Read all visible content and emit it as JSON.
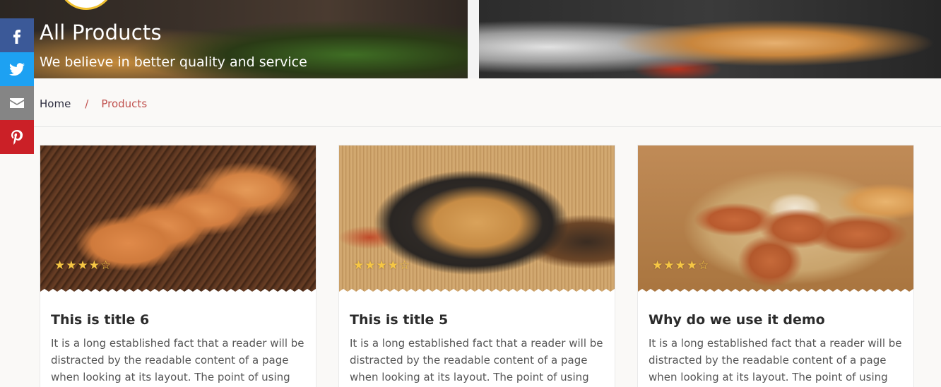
{
  "hero": {
    "title": "All Products",
    "subtitle": "We believe in better quality and service"
  },
  "share": {
    "items": [
      {
        "network": "facebook",
        "icon": "facebook-icon",
        "color": "#3b5998"
      },
      {
        "network": "twitter",
        "icon": "twitter-icon",
        "color": "#1da1f2"
      },
      {
        "network": "email",
        "icon": "mail-icon",
        "color": "#858585"
      },
      {
        "network": "pinterest",
        "icon": "pinterest-icon",
        "color": "#cb2027"
      }
    ]
  },
  "breadcrumb": {
    "home": "Home",
    "separator": "/",
    "current": "Products"
  },
  "colors": {
    "accent": "#c0504d",
    "star": "#f6c644"
  },
  "products": [
    {
      "title": "This is title 6",
      "rating": 4,
      "rating_max": 5,
      "description": "It is a long established fact that a reader will be distracted by the readable content of a page when looking at its layout. The point of using Lorem"
    },
    {
      "title": "This is title 5",
      "rating": 4,
      "rating_max": 5,
      "description": "It is a long established fact that a reader will be distracted by the readable content of a page when looking at its layout. The point of using Lorem"
    },
    {
      "title": "Why do we use it demo",
      "rating": 4,
      "rating_max": 5,
      "description": "It is a long established fact that a reader will be distracted by the readable content of a page when looking at its layout. The point of using Lorem"
    }
  ]
}
